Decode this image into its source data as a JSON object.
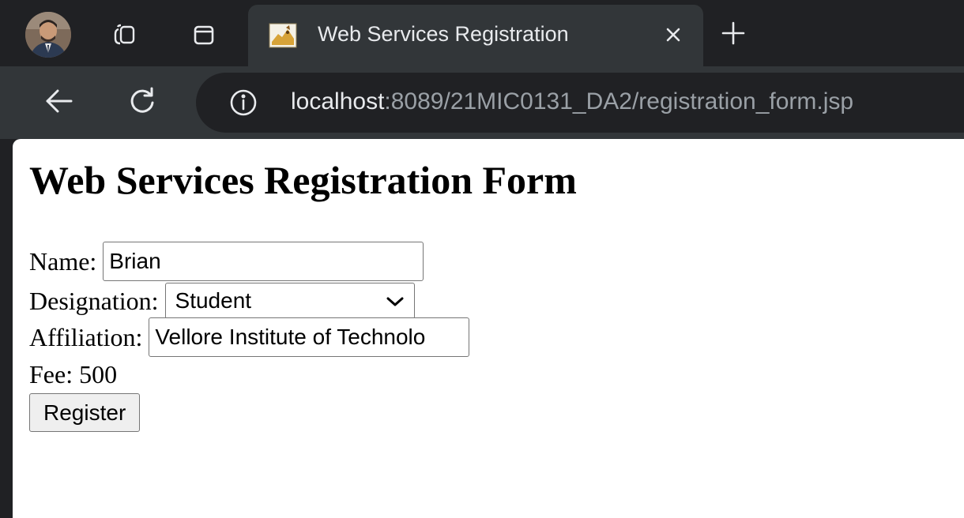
{
  "browser": {
    "tab": {
      "title": "Web Services Registration",
      "close_glyph": "✕"
    },
    "new_tab_glyph": "+",
    "address_bar": {
      "host": "localhost",
      "path": ":8089/21MIC0131_DA2/registration_form.jsp"
    },
    "icons": [
      "profile-avatar",
      "tab-actions-icon",
      "vertical-tabs-icon",
      "tomcat-favicon",
      "close-icon",
      "new-tab-icon",
      "back-arrow-icon",
      "reload-icon",
      "info-icon"
    ]
  },
  "page": {
    "heading": "Web Services Registration Form",
    "form": {
      "name_label": "Name:",
      "name_value": "Brian",
      "designation_label": "Designation:",
      "designation_value": "Student",
      "affiliation_label": "Affiliation:",
      "affiliation_value": "Vellore Institute of Technolo",
      "fee_text": "Fee: 500",
      "register_label": "Register"
    }
  },
  "colors": {
    "tabstrip_bg": "#202124",
    "toolbar_bg": "#323639",
    "omnibox_bg": "#202124",
    "text_light": "#e8eaed",
    "text_muted": "#9aa0a6",
    "page_bg": "#ffffff"
  }
}
